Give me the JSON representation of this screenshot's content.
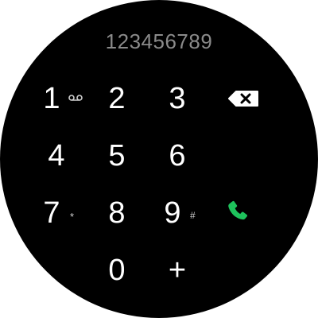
{
  "display": {
    "number": "123456789"
  },
  "keypad": {
    "keys": [
      {
        "digit": "1",
        "sub_icon": "voicemail-icon"
      },
      {
        "digit": "2"
      },
      {
        "digit": "3"
      },
      {
        "digit": "4"
      },
      {
        "digit": "5"
      },
      {
        "digit": "6"
      },
      {
        "digit": "7",
        "sub": "*"
      },
      {
        "digit": "8"
      },
      {
        "digit": "9",
        "sub": "#"
      },
      {
        "digit": "0"
      },
      {
        "digit": "+"
      }
    ]
  },
  "actions": {
    "backspace_icon": "backspace-icon",
    "call_icon": "phone-call-icon"
  },
  "colors": {
    "background": "#000000",
    "digit": "#ffffff",
    "display_text": "#8a8a8a",
    "call_accent": "#1ec25c"
  }
}
